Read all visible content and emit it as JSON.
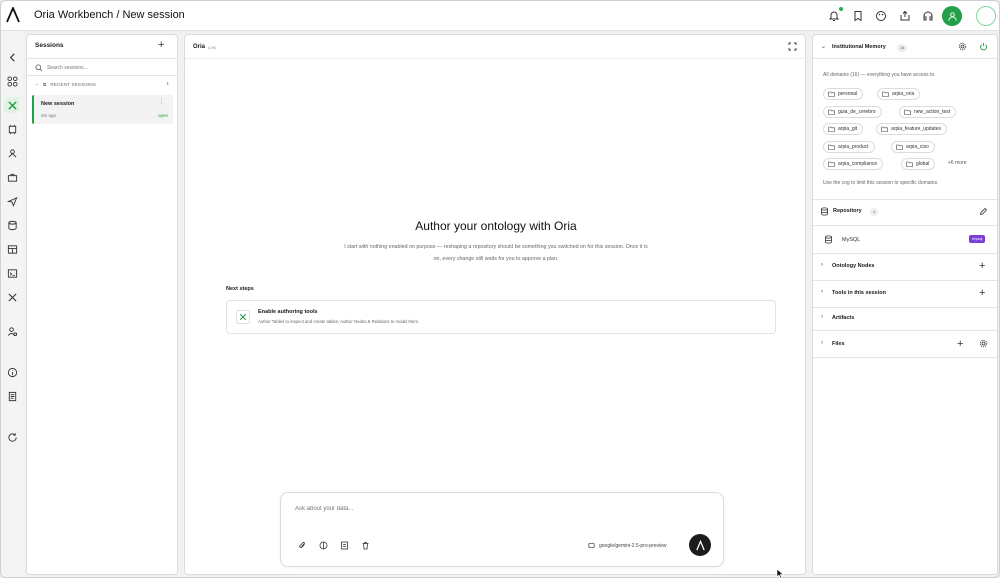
{
  "app": {
    "breadcrumb": "Oria Workbench / New session"
  },
  "sessions": {
    "title": "Sessions",
    "search_placeholder": "Search sessions...",
    "recent_label": "RECENT SESSIONS",
    "recent_count": "1",
    "items": [
      {
        "name": "New session",
        "time": "4m ago",
        "status": "open"
      }
    ]
  },
  "main": {
    "name": "Oria",
    "version": "4.96",
    "hero_title": "Author your ontology with Oria",
    "hero_subtitle": "I start with nothing enabled on purpose — reshaping a repository should be something you switched on for this session. Once it is on, every change still waits for you to approve a plan.",
    "next_steps_label": "Next steps",
    "card_title": "Enable authoring tools",
    "card_subtitle": "Author Tables to inspect and create tables; Author Nodes & Relations to model them.",
    "composer_placeholder": "Ask about your data...",
    "model": "google/gemini-2.5-pro-preview"
  },
  "memory": {
    "title": "Institutional Memory",
    "count": "14",
    "intro": "All domains (16) — everything you have access to.",
    "domains": [
      "personal",
      "arpia_oria",
      "guia_de_cerebro",
      "new_action_test",
      "arpia_git",
      "arpia_feature_updates",
      "arpia_product",
      "arpia_ciso",
      "arpia_compliance",
      "global"
    ],
    "more": "+6 more",
    "note": "Use the cog to limit this session to specific domains."
  },
  "repository": {
    "title": "Repository",
    "count": "1",
    "item": "MySQL",
    "badge": "mysql"
  },
  "sections": {
    "ontology_nodes": "Ontology Nodes",
    "tools": "Tools in this session",
    "artifacts": "Artifacts",
    "files": "Files"
  },
  "colors": {
    "accent": "#22a047",
    "badge_purple": "#7a3fd4"
  }
}
